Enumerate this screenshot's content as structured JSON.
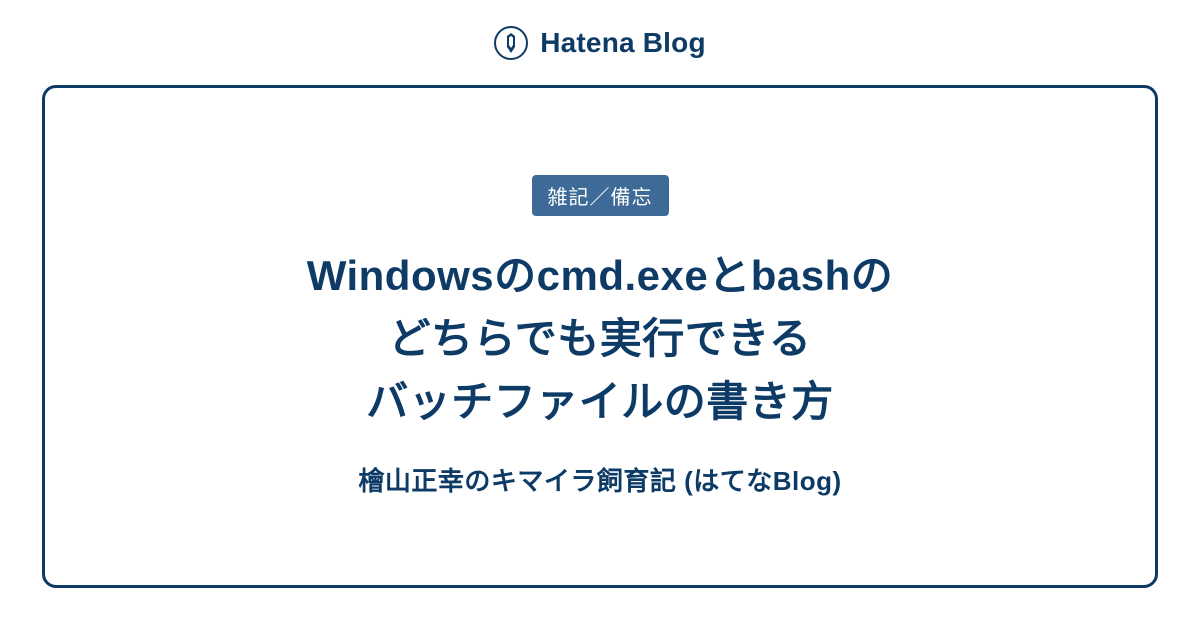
{
  "header": {
    "brand": "Hatena Blog"
  },
  "card": {
    "tag": "雑記／備忘",
    "title_line1": "Windowsのcmd.exeとbashの",
    "title_line2": "どちらでも実行できる",
    "title_line3": "バッチファイルの書き方",
    "blog_name": "檜山正幸のキマイラ飼育記 (はてなBlog)"
  },
  "colors": {
    "primary": "#0d3b66",
    "tag_bg": "#3e6a97",
    "bg": "#ffffff"
  }
}
